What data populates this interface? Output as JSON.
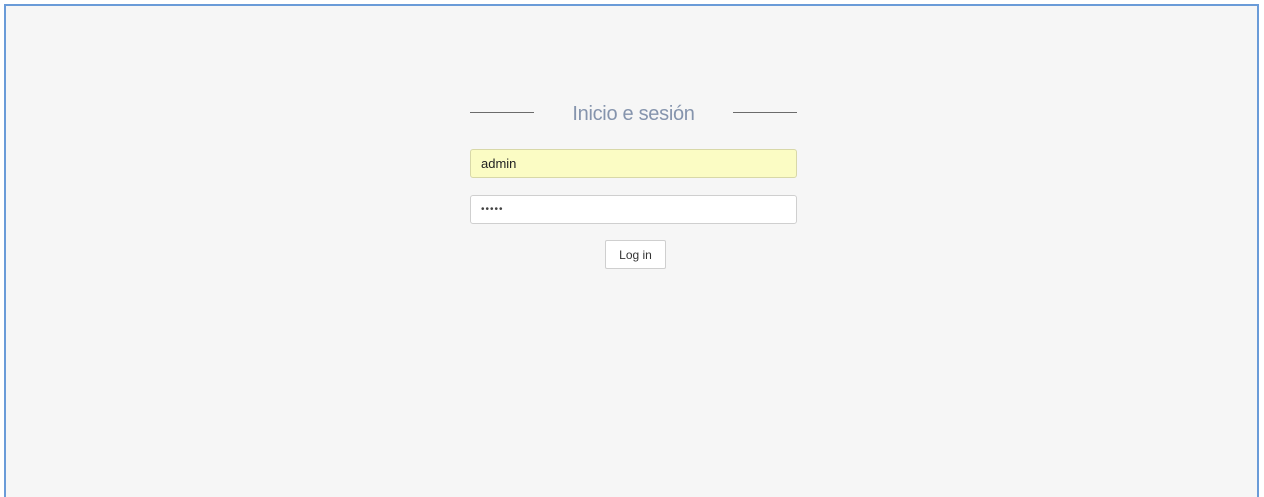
{
  "login": {
    "title": "Inicio e sesión",
    "username_value": "admin",
    "password_value": "•••••",
    "login_button_label": "Log in"
  },
  "colors": {
    "background": "#f6f6f6",
    "frame_border": "#6a9bd8",
    "title": "#8594ad",
    "autofill_background": "#fbfcc4"
  }
}
